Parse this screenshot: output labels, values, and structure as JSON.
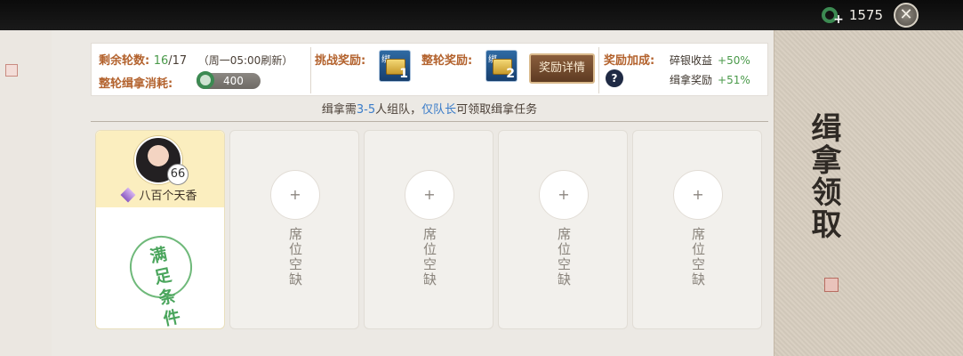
{
  "topbar": {
    "currency_value": "1575",
    "currency_icon": "jade-coin-icon",
    "close_icon": "close-icon"
  },
  "info": {
    "rounds_label": "剩余轮数:",
    "rounds_current": "16",
    "rounds_total": "/17",
    "refresh_note": "（周一05:00刷新）",
    "cost_label": "整轮缉拿消耗:",
    "cost_value": "400",
    "challenge_reward_label": "挑战奖励:",
    "challenge_chest_tag": "绑",
    "challenge_chest_count": "1",
    "round_reward_label": "整轮奖励:",
    "round_chest_tag": "绑",
    "round_chest_count": "2",
    "detail_button": "奖励详情",
    "bonus_label": "奖励加成:",
    "help_icon": "?",
    "bonus_items": [
      {
        "name": "碎银收益",
        "pct": "+50%"
      },
      {
        "name": "缉拿奖励",
        "pct": "+51%"
      }
    ]
  },
  "team_note": {
    "prefix": "缉拿需",
    "range": "3-5",
    "mid": "人组队，",
    "leader": "仅队长",
    "suffix": "可领取缉拿任务"
  },
  "member": {
    "level": "66",
    "name": "八百个天香",
    "stamp_chars": [
      "满",
      "足",
      "条",
      "件"
    ]
  },
  "empty_slots": [
    {
      "plus": "+",
      "label": "席位空缺"
    },
    {
      "plus": "+",
      "label": "席位空缺"
    },
    {
      "plus": "+",
      "label": "席位空缺"
    },
    {
      "plus": "+",
      "label": "席位空缺"
    }
  ],
  "side_title": "缉拿领取",
  "colors": {
    "accent_orange": "#b3622d",
    "green_value": "#4a9a4a",
    "blue_highlight": "#3a7cc9"
  }
}
